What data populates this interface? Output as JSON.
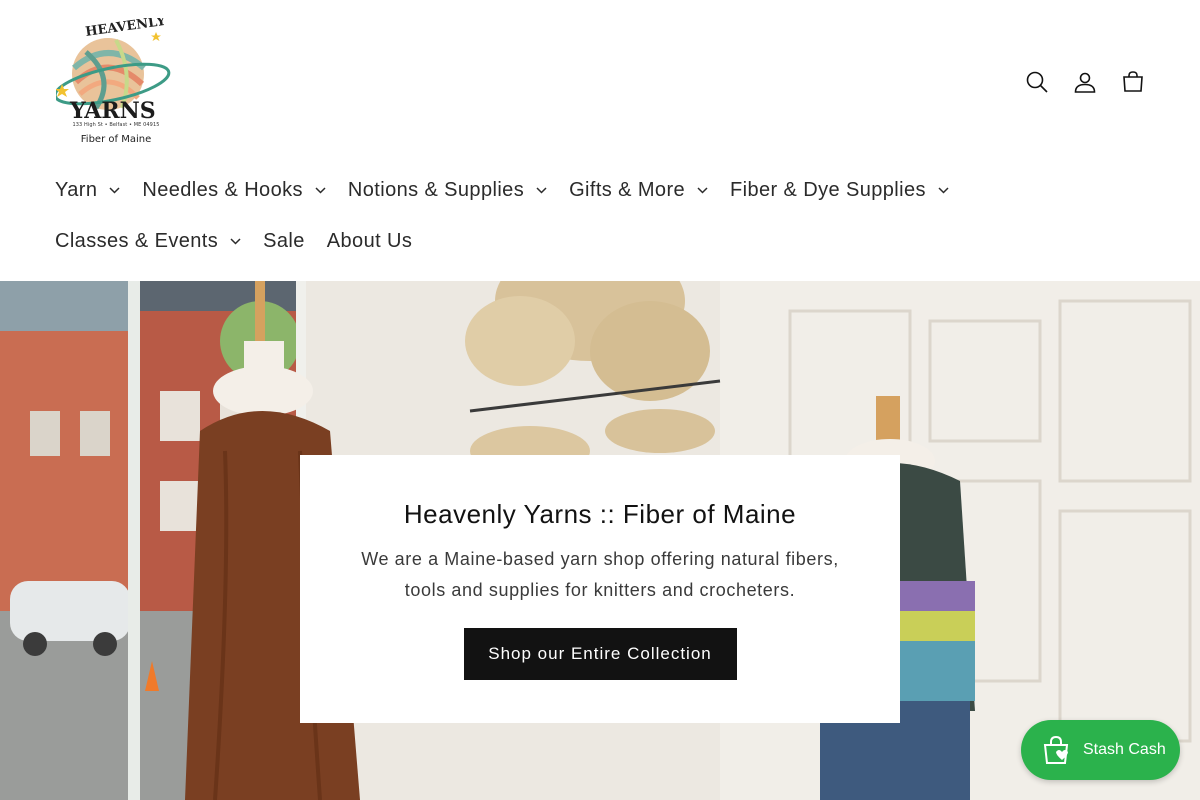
{
  "logo": {
    "word_top": "HEAVENLY",
    "word_main": "YARNS",
    "address": "133 High St • Belfast • ME 04915",
    "tagline": "Fiber of Maine"
  },
  "header_icons": [
    "search-icon",
    "account-icon",
    "cart-icon"
  ],
  "nav": {
    "items": [
      {
        "label": "Yarn",
        "has_dropdown": true
      },
      {
        "label": "Needles & Hooks",
        "has_dropdown": true
      },
      {
        "label": "Notions & Supplies",
        "has_dropdown": true
      },
      {
        "label": "Gifts & More",
        "has_dropdown": true
      },
      {
        "label": "Fiber & Dye Supplies",
        "has_dropdown": true
      },
      {
        "label": "Classes & Events",
        "has_dropdown": true
      },
      {
        "label": "Sale",
        "has_dropdown": false
      },
      {
        "label": "About Us",
        "has_dropdown": false
      }
    ]
  },
  "hero": {
    "title": "Heavenly Yarns :: Fiber of Maine",
    "text": "We are a Maine-based yarn shop offering natural fibers, tools and supplies for knitters and crocheters.",
    "button_label": "Shop our Entire Collection"
  },
  "stash_widget": {
    "label": "Stash Cash",
    "color": "#2bb24c",
    "icon": "shopping-bag-heart-icon"
  },
  "colors": {
    "text": "#121212",
    "button_bg": "#121212",
    "accent_green": "#2bb24c"
  }
}
